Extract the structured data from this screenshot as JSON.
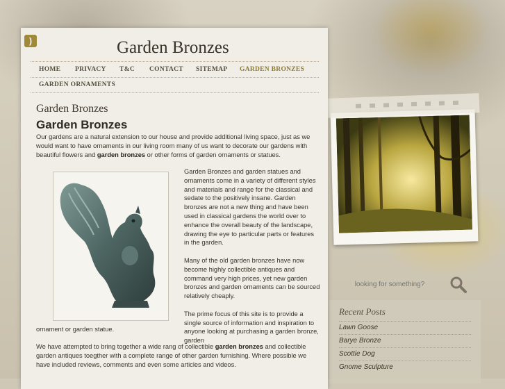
{
  "site": {
    "title": "Garden Bronzes",
    "rss_icon": "rss-icon"
  },
  "nav": {
    "items": [
      {
        "label": "HOME"
      },
      {
        "label": "PRIVACY"
      },
      {
        "label": "T&C"
      },
      {
        "label": "CONTACT"
      },
      {
        "label": "SITEMAP"
      },
      {
        "label": "GARDEN BRONZES",
        "active": true
      },
      {
        "label": "GARDEN ORNAMENTS"
      }
    ],
    "active_color": "#8c7a33"
  },
  "page": {
    "heading": "Garden Bronzes",
    "post_title": "Garden Bronzes",
    "p1_a": "Our gardens are a natural extension to our house and provide additional living space, just as we would want to have ornaments in our living room many of us want to decorate our gardens with beautiful flowers and ",
    "p1_b": "garden bronzes",
    "p1_c": " or other forms of garden ornaments or statues.",
    "p2": "Garden Bronzes and garden statues and ornaments come in a variety of different styles and materials and range for the classical and sedate to the positively insane. Garden bronzes are not a new thing and have been used in classical gardens the world over to enhance the overall beauty of the landscape, drawing the eye to particular parts or features in the garden.",
    "p3": "Many of the old garden bronzes have now become highly collectible antiques and command very high prices, yet new garden bronzes and garden ornaments can be sourced relatively cheaply.",
    "p4": "The prime focus of this site is to provide a single source of information and inspiration to anyone looking at purchasing a garden bronze, garden",
    "p4_end": "ornament or garden statue.",
    "p5_a": "We have attempted to bring together a wide rang of collectible ",
    "p5_b": "garden bronzes",
    "p5_c": " and collectible garden antiques toegther with a complete range of other garden furnishing.  Where possible we have included reviews, comments and even some articles and videos.",
    "image_subject": "bronze squirrel statue"
  },
  "sidebar": {
    "search_placeholder": "looking for something?",
    "search_icon": "magnifier-icon",
    "recent_title": "Recent Posts",
    "recent_posts": [
      "Lawn Goose",
      "Barye Bronze",
      "Scottie Dog",
      "Gnome Sculpture"
    ]
  }
}
